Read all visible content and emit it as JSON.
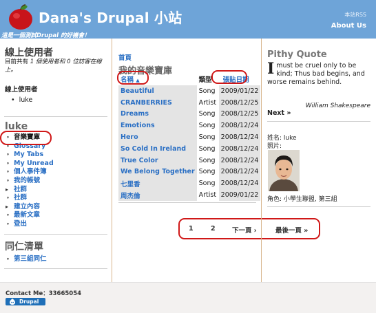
{
  "header": {
    "site_name": "Dana's Drupal 小站",
    "slogan": "這是一個測試Drupal 的好機會！",
    "rss_label": "本站RSS",
    "about_label": "About Us",
    "brand_color": "#6ea4d8"
  },
  "online": {
    "title": "線上使用者",
    "summary_prefix": "目前共有",
    "user_count": "1",
    "summary_users": "個使用者和",
    "guest_count": "0",
    "summary_guests": "位訪客在線上。",
    "subtitle": "線上使用者",
    "users": [
      "luke"
    ]
  },
  "nav": {
    "title": "luke",
    "items": [
      {
        "label": "音樂寶庫",
        "bullet": "⚬",
        "active": true
      },
      {
        "label": "Glossary",
        "bullet": "⚬"
      },
      {
        "label": "My Tabs",
        "bullet": "⚬"
      },
      {
        "label": "My Unread",
        "bullet": "⚬"
      },
      {
        "label": "個人事件簿",
        "bullet": "⚬"
      },
      {
        "label": "我的帳號",
        "bullet": "⚬"
      },
      {
        "label": "社群",
        "bullet": "▸"
      },
      {
        "label": "社群",
        "bullet": "⚬"
      },
      {
        "label": "建立內容",
        "bullet": "▸"
      },
      {
        "label": "最新文章",
        "bullet": "⚬"
      },
      {
        "label": "登出",
        "bullet": "⚬"
      }
    ]
  },
  "friends": {
    "title": "同仁清單",
    "items": [
      {
        "label": "第三組同仁",
        "bullet": "⚬"
      }
    ]
  },
  "main": {
    "breadcrumb": "首頁",
    "page_title": "我的音樂寶庫",
    "columns": {
      "name": "名稱",
      "type": "類型",
      "date": "張貼日期"
    },
    "sort_indicator": "▲",
    "rows": [
      {
        "name": "Beautiful",
        "type": "Song",
        "date": "2009/01/22"
      },
      {
        "name": "CRANBERRIES",
        "type": "Artist",
        "date": "2008/12/25"
      },
      {
        "name": "Dreams",
        "type": "Song",
        "date": "2008/12/25"
      },
      {
        "name": "Emotions",
        "type": "Song",
        "date": "2008/12/24"
      },
      {
        "name": "Hero",
        "type": "Song",
        "date": "2008/12/24"
      },
      {
        "name": "So Cold In Ireland",
        "type": "Song",
        "date": "2008/12/24"
      },
      {
        "name": "True Color",
        "type": "Song",
        "date": "2008/12/24"
      },
      {
        "name": "We Belong Together",
        "type": "Song",
        "date": "2008/12/24"
      },
      {
        "name": "七里香",
        "type": "Song",
        "date": "2008/12/24"
      },
      {
        "name": "周杰倫",
        "type": "Artist",
        "date": "2009/01/22"
      }
    ],
    "pager": {
      "page1": "1",
      "page2": "2",
      "next": "下一頁 ›",
      "last": "最後一頁 »"
    }
  },
  "quote": {
    "title": "Pithy Quote",
    "dropcap": "I",
    "text": "must be cruel only to be kind; Thus bad begins, and worse remains behind.",
    "author": "William Shakespeare",
    "next_label": "Next »"
  },
  "profile": {
    "name_line": "姓名: luke",
    "photo_label": "照片:",
    "role_line": "角色: 小學生聯盟, 第三組"
  },
  "footer": {
    "contact": "Contact Me：33665054",
    "badge": "Drupal"
  }
}
